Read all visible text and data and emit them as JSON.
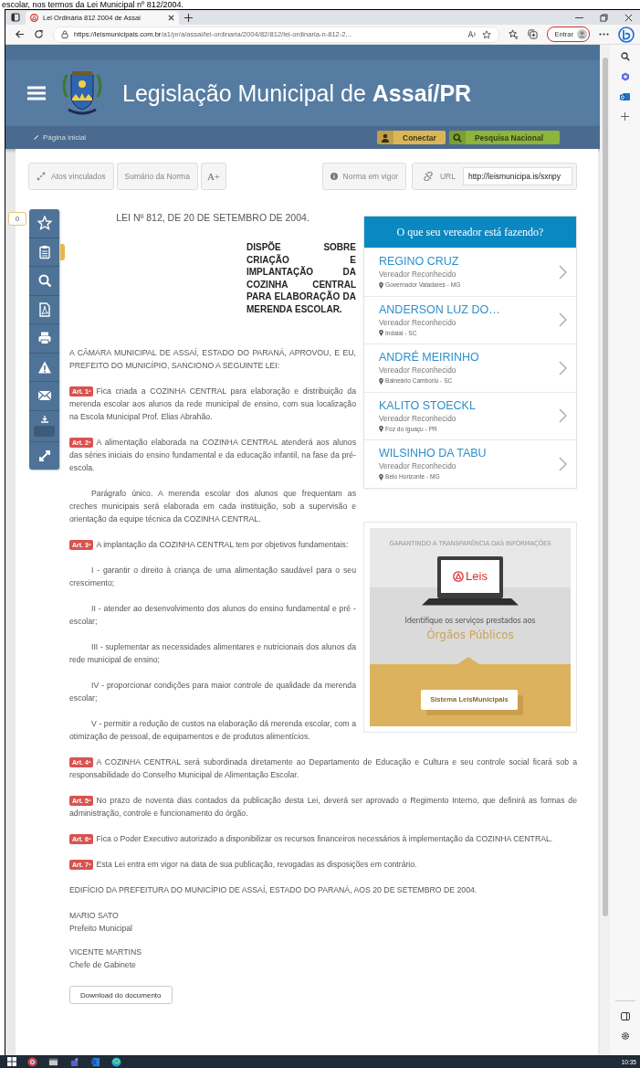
{
  "caption": "escolar, nos termos da Lei Municipal nº 812/2004.",
  "browser": {
    "tab_title": "Lei Ordinária 812 2004 de Assaí",
    "url_host": "https://leismunicipais.com.br",
    "url_path": "/a1/pr/a/assai/lei-ordinaria/2004/82/812/lei-ordinaria-n-812-2...",
    "profile_button": "Entrar"
  },
  "site": {
    "title": "Legislação Municipal de **Assaí/PR**",
    "breadcrumb": "Página inicial",
    "buttons": [
      {
        "kind": "login",
        "label": "Conectar"
      },
      {
        "kind": "search",
        "label": "Pesquisa Nacional"
      }
    ]
  },
  "toolbar": {
    "buttons": [
      {
        "kind": "links",
        "label": "Atos vinculados"
      },
      {
        "kind": "plain",
        "label": "Sumário da Norma"
      },
      {
        "kind": "font",
        "label": "A+"
      },
      {
        "kind": "info",
        "label": "Norma em vigor"
      }
    ],
    "url_label": "URL",
    "url_value": "http://leismunicipa.is/sxnpy"
  },
  "side_tools": {
    "favorites_count": "0"
  },
  "document": {
    "title": "LEI Nº 812, DE 20 DE SETEMBRO DE 2004.",
    "ementa": "DISPÕE SOBRE CRIAÇÃO E IMPLANTAÇÃO DA COZINHA CENTRAL PARA ELABORAÇÃO DA MERENDA ESCOLAR.",
    "paragraphs": [
      {
        "kind": "plain",
        "text": "A CÂMARA MUNICIPAL DE ASSAÍ, ESTADO DO PARANÁ, APROVOU, E EU, PREFEITO DO MUNICÍPIO, SANCIONO A SEGUINTE LEI:"
      },
      {
        "kind": "article",
        "label": "Art. 1º",
        "text": "Fica criada a COZINHA CENTRAL para elaboração e distribuição da merenda escolar aos alunos da rede municipal de ensino, com sua localização na Escola Municipal Prof. Elias Abrahão."
      },
      {
        "kind": "article",
        "label": "Art. 2º",
        "text": "A alimentação elaborada na COZINHA CENTRAL atenderá aos alunos das séries iniciais do ensino fundamental e da educação infantil, na fase da pré-escola."
      },
      {
        "kind": "indented",
        "text": "Parágrafo único. A merenda escolar dos alunos que frequentam as creches municipais será elaborada em cada instituição, sob a supervisão e orientação da equipe técnica da COZINHA CENTRAL."
      },
      {
        "kind": "article",
        "label": "Art. 3º",
        "text": "A implantação da COZINHA CENTRAL tem por objetivos fundamentais:"
      },
      {
        "kind": "indented",
        "text": "I - garantir o direito à criança de uma alimentação saudável para o seu crescimento;"
      },
      {
        "kind": "indented",
        "text": "II - atender ao desenvolvimento dos alunos do ensino fundamental e pré - escolar;"
      },
      {
        "kind": "indented",
        "text": "III - suplementar as necessidades alimentares e nutricionais dos alunos da rede municipal de ensino;"
      },
      {
        "kind": "indented",
        "text": "IV - proporcionar condições para maior controle de qualidade da merenda escolar;"
      },
      {
        "kind": "indented",
        "text": "V - permitir a redução de custos na elaboração dá merenda escolar, com a otimização de pessoal, de equipamentos e de produtos alimentícios."
      },
      {
        "kind": "article",
        "label": "Art. 4º",
        "text": "A COZINHA CENTRAL será subordinada diretamente ao Departamento de Educação e Cultura e seu controle social ficará sob a responsabilidade do Conselho Municipal de Alimentação Escolar."
      },
      {
        "kind": "article",
        "label": "Art. 5º",
        "text": "No prazo de noventa dias contados da publicação desta Lei, deverá ser aprovado o Regimento Interno, que definirá as formas de administração, controle e funcionamento do órgão."
      },
      {
        "kind": "article",
        "label": "Art. 6º",
        "text": "Fica o Poder Executivo autorizado a disponibilizar os recursos financeiros necessários à implementação da COZINHA CENTRAL."
      },
      {
        "kind": "article",
        "label": "Art. 7º",
        "text": "Esta Lei entra em vigor na data de sua publicação, revogadas as disposições em contrário."
      },
      {
        "kind": "plain",
        "text": "EDIFÍCIO DA PREFEITURA DO MUNICÍPIO DE ASSAÍ, ESTADO DO PARANÁ, AOS 20 DE SETEMBRO DE 2004."
      }
    ],
    "signatures": [
      {
        "name": "MARIO SATO",
        "role": "Prefeito Municipal"
      },
      {
        "name": "VICENTE MARTINS",
        "role": "Chefe de Gabinete"
      }
    ],
    "download_button": "Download do documento"
  },
  "vereadores": {
    "title": "O que seu vereador está fazendo?",
    "items": [
      {
        "name": "REGINO CRUZ",
        "role": "Vereador Reconhecido",
        "place": "Governador Valadares - MG"
      },
      {
        "name": "ANDERSON LUZ DO…",
        "role": "Vereador Reconhecido",
        "place": "Indaial - SC"
      },
      {
        "name": "ANDRÉ MEIRINHO",
        "role": "Vereador Reconhecido",
        "place": "Balneário Camboriú - SC"
      },
      {
        "name": "KALITO STOECKL",
        "role": "Vereador Reconhecido",
        "place": "Foz do Iguaçu - PR"
      },
      {
        "name": "WILSINHO DA TABU",
        "role": "Vereador Reconhecido",
        "place": "Belo Horizonte - MG"
      }
    ]
  },
  "promo": {
    "heading": "GARANTINDO A TRANSPARÊNCIA DAS INFORMAÇÕES",
    "logo_text": "Leis",
    "line": "Identifique os serviços prestados aos",
    "highlight": "Órgãos Públicos",
    "button": "Sistema LeisMunicipais"
  },
  "taskbar": {
    "time": "10:35"
  }
}
